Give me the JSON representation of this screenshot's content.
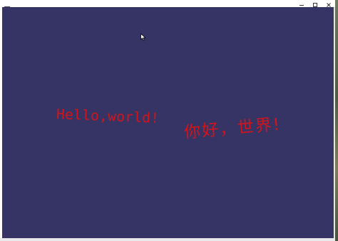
{
  "window": {
    "icon": "window-icon",
    "buttons": {
      "minimize": "minimize-icon",
      "maximize": "maximize-icon",
      "close": "close-icon"
    }
  },
  "canvas": {
    "background": "#353465",
    "text_color": "#d4141a",
    "english_text": "Hello,world!",
    "chinese_text": "你好，世界!"
  },
  "colors": {
    "titlebar": "#ffffff",
    "text": "#d4141a",
    "canvas": "#353465"
  }
}
